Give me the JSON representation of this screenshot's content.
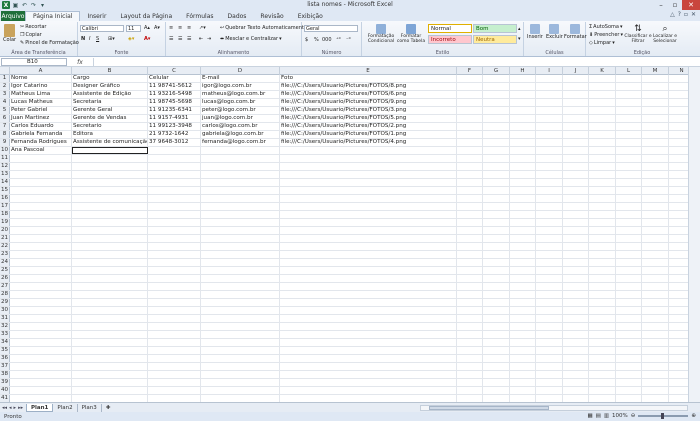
{
  "window": {
    "title": "lista nomes - Microsoft Excel",
    "logo": "X"
  },
  "ribbon_tabs": [
    "Arquivo",
    "Página Inicial",
    "Inserir",
    "Layout da Página",
    "Fórmulas",
    "Dados",
    "Revisão",
    "Exibição"
  ],
  "clipboard": {
    "paste": "Colar",
    "cut": "Recortar",
    "copy": "Copiar",
    "format_painter": "Pincel de Formatação",
    "label": "Área de Transferência"
  },
  "font": {
    "name": "Calibri",
    "size": "11",
    "bold": "N",
    "italic": "I",
    "underline": "S",
    "label": "Fonte"
  },
  "alignment": {
    "wrap": "Quebrar Texto Automaticamente",
    "merge": "Mesclar e Centralizar",
    "label": "Alinhamento"
  },
  "number": {
    "format": "Geral",
    "currency": "$",
    "percent": "%",
    "thousands": "000",
    "label": "Número"
  },
  "styles": {
    "conditional": "Formatação Condicional",
    "table": "Formatar como Tabela",
    "normal": "Normal",
    "bom": "Bom",
    "incorreto": "Incorreto",
    "neutra": "Neutra",
    "label": "Estilo"
  },
  "cells_group": {
    "insert": "Inserir",
    "delete": "Excluir",
    "format": "Formatar",
    "label": "Células"
  },
  "editing": {
    "autosum": "AutoSoma",
    "fill": "Preencher",
    "clear": "Limpar",
    "sort": "Classificar e Filtrar",
    "find": "Localizar e Selecionar",
    "label": "Edição"
  },
  "formula_bar": {
    "name_box": "B10",
    "fx": "fx",
    "formula": ""
  },
  "columns": [
    "A",
    "B",
    "C",
    "D",
    "E",
    "F",
    "G",
    "H",
    "I",
    "J",
    "K",
    "L",
    "M",
    "N"
  ],
  "table": {
    "headers": [
      "Nome",
      "Cargo",
      "Celular",
      "E-mail",
      "Foto"
    ],
    "rows": [
      [
        "Igor Catarino",
        "Designer Gráfico",
        "11 98741-5612",
        "igor@logo.com.br",
        "file:///C:/Users/Usuario/Pictures/FOTOS/8.png"
      ],
      [
        "Matheus Lima",
        "Assistente de Edição",
        "11 93216-5498",
        "matheus@logo.com.br",
        "file:///C:/Users/Usuario/Pictures/FOTOS/6.png"
      ],
      [
        "Lucas Matheus",
        "Secretaria",
        "11 98745-5698",
        "lucas@logo.com.br",
        "file:///C:/Users/Usuario/Pictures/FOTOS/9.png"
      ],
      [
        "Peter Gabriel",
        "Gerente Geral",
        "11 91235-6341",
        "peter@logo.com.br",
        "file:///C:/Users/Usuario/Pictures/FOTOS/3.png"
      ],
      [
        "Juan Martinez",
        "Gerente de Vendas",
        "11 9157-4931",
        "juan@logo.com.br",
        "file:///C:/Users/Usuario/Pictures/FOTOS/5.png"
      ],
      [
        "Carlos Eduardo",
        "Secretario",
        "11 99123-3948",
        "carlos@logo.com.br",
        "file:///C:/Users/Usuario/Pictures/FOTOS/2.png"
      ],
      [
        "Gabriela Fernanda",
        "Editora",
        "21 9732-1642",
        "gabriela@logo.com.br",
        "file:///C:/Users/Usuario/Pictures/FOTOS/1.png"
      ],
      [
        "Fernanda Rodrigues",
        "Assistente de comunicação",
        "37 9648-3012",
        "fernanda@logo.com.br",
        "file:///C:/Users/Usuario/Pictures/FOTOS/4.png"
      ],
      [
        "Ana Pascoal",
        "",
        "",
        "",
        ""
      ]
    ]
  },
  "sheets": [
    "Plan1",
    "Plan2",
    "Plan3"
  ],
  "status": {
    "ready": "Pronto",
    "zoom": "100%"
  }
}
